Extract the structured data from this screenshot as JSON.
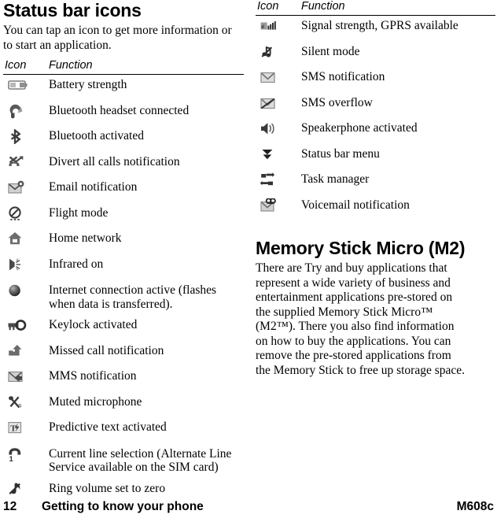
{
  "left_column": {
    "title": "Status bar icons",
    "intro": "You can tap an icon to get more information or to start an application.",
    "table": {
      "headers": {
        "icon": "Icon",
        "function": "Function"
      },
      "rows": [
        {
          "icon": "battery-strength-icon",
          "function": "Battery strength"
        },
        {
          "icon": "bluetooth-headset-icon",
          "function": "Bluetooth headset connected"
        },
        {
          "icon": "bluetooth-icon",
          "function": "Bluetooth activated"
        },
        {
          "icon": "divert-calls-icon",
          "function": "Divert all calls notification"
        },
        {
          "icon": "email-notification-icon",
          "function": "Email notification"
        },
        {
          "icon": "flight-mode-icon",
          "function": "Flight mode"
        },
        {
          "icon": "home-network-icon",
          "function": "Home network"
        },
        {
          "icon": "infrared-icon",
          "function": "Infrared on"
        },
        {
          "icon": "internet-connection-icon",
          "function": "Internet connection active (flashes when data is transferred)."
        },
        {
          "icon": "keylock-icon",
          "function": "Keylock activated"
        },
        {
          "icon": "missed-call-icon",
          "function": "Missed call notification"
        },
        {
          "icon": "mms-notification-icon",
          "function": "MMS notification"
        },
        {
          "icon": "muted-microphone-icon",
          "function": "Muted microphone"
        },
        {
          "icon": "predictive-text-icon",
          "function": "Predictive text activated"
        },
        {
          "icon": "line-selection-icon",
          "function": "Current line selection (Alternate Line Service available on the SIM card)"
        },
        {
          "icon": "ring-volume-zero-icon",
          "function": "Ring volume set to zero"
        }
      ]
    }
  },
  "right_column": {
    "table": {
      "headers": {
        "icon": "Icon",
        "function": "Function"
      },
      "rows": [
        {
          "icon": "signal-strength-gprs-icon",
          "function": "Signal strength, GPRS available"
        },
        {
          "icon": "silent-mode-icon",
          "function": "Silent mode"
        },
        {
          "icon": "sms-notification-icon",
          "function": "SMS notification"
        },
        {
          "icon": "sms-overflow-icon",
          "function": "SMS overflow"
        },
        {
          "icon": "speakerphone-icon",
          "function": "Speakerphone activated"
        },
        {
          "icon": "status-bar-menu-icon",
          "function": "Status bar menu"
        },
        {
          "icon": "task-manager-icon",
          "function": "Task manager"
        },
        {
          "icon": "voicemail-notification-icon",
          "function": "Voicemail notification"
        }
      ]
    },
    "section_title": "Memory Stick Micro (M2)",
    "section_body": "There are Try and buy applications that represent a wide variety of business and entertainment applications pre-stored on the supplied Memory Stick Micro™ (M2™). There you also find information on how to buy the applications. You can remove the pre-stored applications from the Memory Stick to free up storage space."
  },
  "footer": {
    "page_number": "12",
    "chapter": "Getting to know your phone",
    "model": "M608c"
  },
  "colors": {
    "text": "#000000",
    "rule": "#000000",
    "icon_dark": "#3a3a3a",
    "icon_mid": "#808080",
    "icon_light": "#c8c8c8",
    "background": "#ffffff"
  }
}
